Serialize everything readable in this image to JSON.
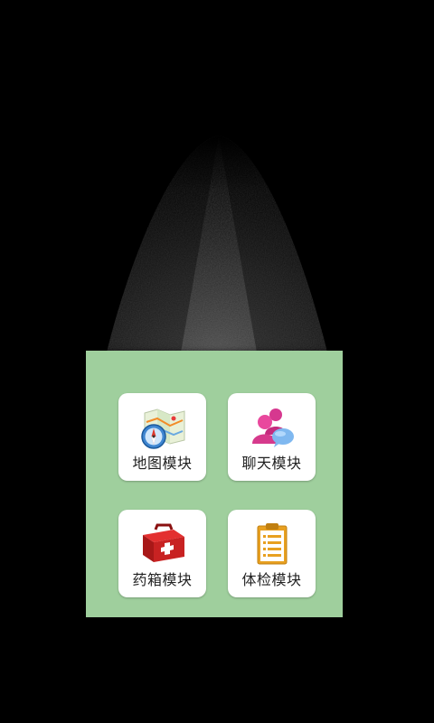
{
  "modules": [
    {
      "id": "map",
      "label": "地图模块",
      "icon": "map-compass-icon"
    },
    {
      "id": "chat",
      "label": "聊天模块",
      "icon": "chat-people-icon"
    },
    {
      "id": "medicine",
      "label": "药箱模块",
      "icon": "first-aid-kit-icon"
    },
    {
      "id": "exam",
      "label": "体检模块",
      "icon": "clipboard-icon"
    }
  ],
  "colors": {
    "background": "#000000",
    "panel": "#9fcf9d",
    "tile": "#ffffff",
    "label": "#222222"
  }
}
